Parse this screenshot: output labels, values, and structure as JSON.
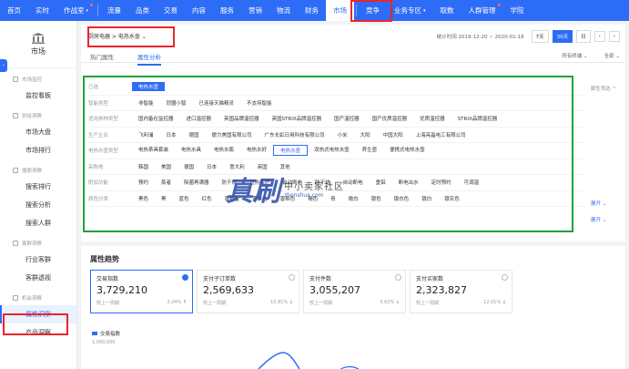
{
  "topnav": {
    "items": [
      {
        "label": "首页",
        "dot": false,
        "caret": false
      },
      {
        "label": "实时",
        "dot": false,
        "caret": false
      },
      {
        "label": "作战室",
        "dot": true,
        "caret": true
      },
      {
        "label": "流量",
        "dot": false,
        "caret": false
      },
      {
        "label": "品类",
        "dot": false,
        "caret": false
      },
      {
        "label": "交易",
        "dot": false,
        "caret": false
      },
      {
        "label": "内容",
        "dot": false,
        "caret": false
      },
      {
        "label": "服务",
        "dot": false,
        "caret": false
      },
      {
        "label": "营销",
        "dot": false,
        "caret": false
      },
      {
        "label": "物流",
        "dot": false,
        "caret": false
      },
      {
        "label": "财务",
        "dot": false,
        "caret": false
      },
      {
        "label": "市场",
        "dot": false,
        "caret": false
      },
      {
        "label": "竞争",
        "dot": false,
        "caret": false
      },
      {
        "label": "业务专区",
        "dot": false,
        "caret": true
      },
      {
        "label": "取数",
        "dot": false,
        "caret": false
      },
      {
        "label": "人群管理",
        "dot": true,
        "caret": false
      },
      {
        "label": "学院",
        "dot": false,
        "caret": false
      }
    ],
    "active_index": 11,
    "accent": "#2d6cf6"
  },
  "sidebar": {
    "title": "市场",
    "groups": [
      {
        "label": "市场监控",
        "items": [
          "监控看板"
        ]
      },
      {
        "label": "供给洞察",
        "items": [
          "市场大盘",
          "市场排行"
        ]
      },
      {
        "label": "搜索洞察",
        "items": [
          "搜索排行",
          "搜索分析",
          "搜索人群"
        ]
      },
      {
        "label": "客群洞察",
        "items": [
          "行业客群",
          "客群透视"
        ]
      },
      {
        "label": "机会洞察",
        "items": [
          "属性洞察",
          "产品洞察"
        ]
      }
    ],
    "active_item": "属性洞察"
  },
  "header": {
    "breadcrumb": "厨房电器 > 电热水壶",
    "date_range": "统计时间 2019-12-20 ~ 2020-01-18",
    "btn_7": "7天",
    "btn_30": "30天",
    "btn_day": "日"
  },
  "tabs": {
    "items": [
      "热门属性",
      "属性分析"
    ],
    "active": 1,
    "filter1": "所有终端",
    "filter2": "全部"
  },
  "attributes": {
    "right_note": "属性筛选 ^",
    "expand_label": "展开",
    "rows": [
      {
        "label": "已选",
        "values": [
          "电热水壶"
        ],
        "selfill": [
          0
        ]
      },
      {
        "label": "智能类型",
        "values": [
          "非智能",
          "同盟小智",
          "已连接天猫精灵",
          "不支持智能"
        ]
      },
      {
        "label": "适用券种类型",
        "values": [
          "国内备在监控器",
          "进口温控器",
          "英国品牌温控器",
          "英国STRIX品牌温控器",
          "国产温控器",
          "国产优质温控器",
          "优质温控器",
          "STRIX品牌温控器"
        ]
      },
      {
        "label": "生产企业",
        "values": [
          "飞利浦",
          "日本",
          "德国",
          "便力美国有限公司",
          "广东长虹日用科技有限公司",
          "小米",
          "大阳",
          "中国大阳",
          "上海亮晶电工有限公司"
        ]
      },
      {
        "label": "电热水壶类型",
        "values": [
          "电热茶具套装",
          "电热水具",
          "电热水瓶",
          "电热水好",
          "电热水壶",
          "双热式电热水壶",
          "养生壶",
          "便携式电热水壶"
        ],
        "sel": [
          4
        ]
      },
      {
        "label": "采购地",
        "values": [
          "韩国",
          "美国",
          "德国",
          "日本",
          "意大利",
          "英国",
          "其他"
        ]
      },
      {
        "label": "附加功能",
        "values": [
          "预约",
          "蒸者",
          "除菌再满器",
          "防干烧",
          "过热保护",
          "自动断电",
          "防干烧",
          "自动断电",
          "重铝",
          "断电出水",
          "定时预约",
          "可调温"
        ]
      },
      {
        "label": "颜色分类",
        "values": [
          "黑色",
          "黑",
          "蓝色",
          "红色",
          "香槟金",
          "香槟色",
          "香槟色",
          "褐色",
          "青",
          "微白",
          "银色",
          "银白色",
          "银白",
          "银灰色"
        ]
      }
    ]
  },
  "trend": {
    "title": "属性趋势",
    "cards": [
      {
        "title": "交易指数",
        "value": "3,729,210",
        "compare": "较上一周期",
        "pct": "3.24%",
        "dir": "up",
        "checked": true
      },
      {
        "title": "支付子订单数",
        "value": "2,569,633",
        "compare": "较上一周期",
        "pct": "10.81%",
        "dir": "down",
        "checked": false
      },
      {
        "title": "支付件数",
        "value": "3,055,207",
        "compare": "较上一周期",
        "pct": "5.63%",
        "dir": "down",
        "checked": false
      },
      {
        "title": "支付买家数",
        "value": "2,323,827",
        "compare": "较上一周期",
        "pct": "12.01%",
        "dir": "down",
        "checked": false
      }
    ],
    "legend": "交易指数",
    "ytick": "1,000,000"
  },
  "watermark": {
    "big": "真刷",
    "line1": "中小卖家社区",
    "line2": "zhenshua.com"
  }
}
